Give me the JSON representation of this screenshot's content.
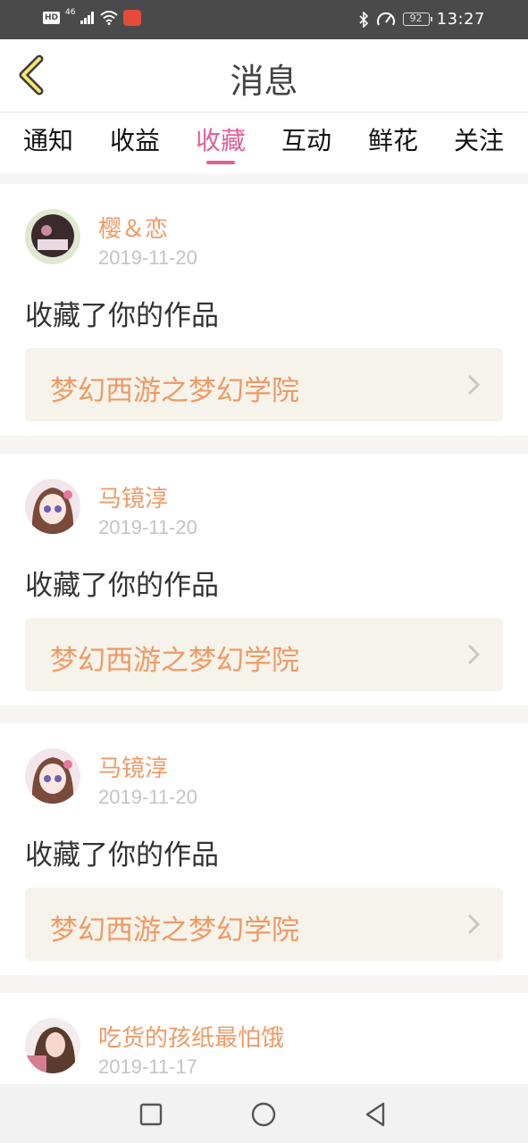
{
  "status": {
    "hd": "HD",
    "net": "46",
    "battery": "92",
    "time": "13:27"
  },
  "header": {
    "title": "消息"
  },
  "tabs": [
    {
      "label": "通知"
    },
    {
      "label": "收益"
    },
    {
      "label": "收藏",
      "active": true
    },
    {
      "label": "互动"
    },
    {
      "label": "鲜花"
    },
    {
      "label": "关注"
    }
  ],
  "cards": [
    {
      "name": "樱＆恋",
      "date": "2019-11-20",
      "action": "收藏了你的作品",
      "work": "梦幻西游之梦幻学院"
    },
    {
      "name": "马镜淳",
      "date": "2019-11-20",
      "action": "收藏了你的作品",
      "work": "梦幻西游之梦幻学院"
    },
    {
      "name": "马镜淳",
      "date": "2019-11-20",
      "action": "收藏了你的作品",
      "work": "梦幻西游之梦幻学院"
    },
    {
      "name": "吃货的孩纸最怕饿",
      "date": "2019-11-17"
    }
  ],
  "colors": {
    "accent": "#e0609a",
    "username": "#ee9a66",
    "workbox": "#f5f3ea"
  }
}
